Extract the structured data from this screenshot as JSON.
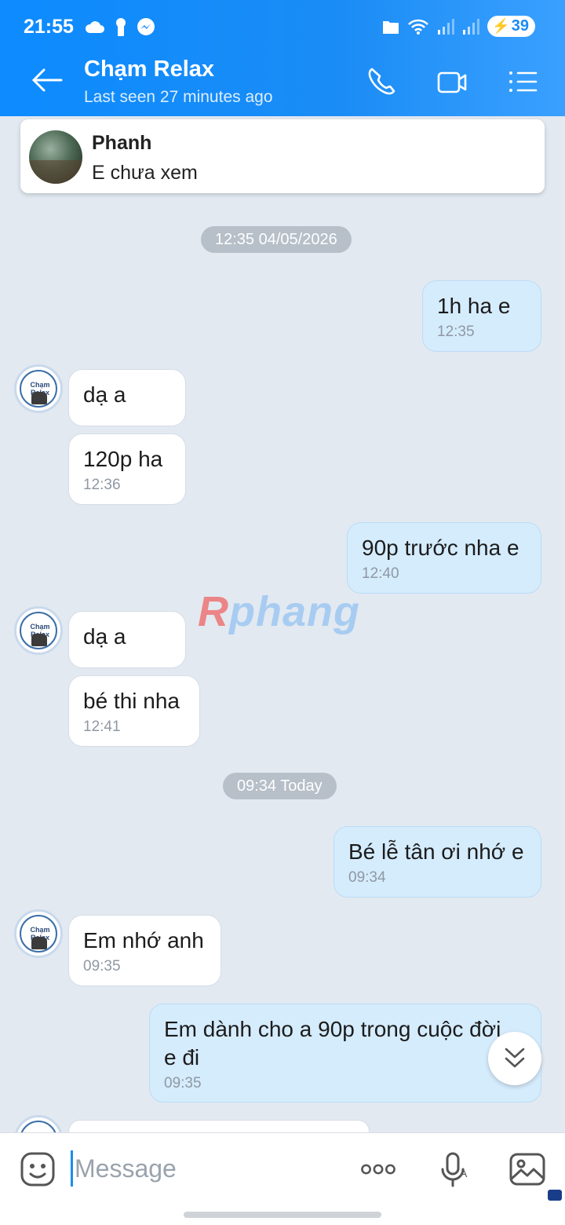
{
  "status_bar": {
    "time": "21:55",
    "battery": "39"
  },
  "header": {
    "title": "Chạm Relax",
    "subtitle": "Last seen 27 minutes ago"
  },
  "pinned": {
    "sender": "Phanh",
    "text": "E chưa xem"
  },
  "chips": [
    "12:35 04/05/2026",
    "09:34 Today"
  ],
  "messages": [
    {
      "dir": "out",
      "text": "1h ha e",
      "time": "12:35"
    },
    {
      "dir": "in",
      "text": "dạ a",
      "time": ""
    },
    {
      "dir": "in",
      "text": "120p ha",
      "time": "12:36"
    },
    {
      "dir": "out",
      "text": "90p trước nha e",
      "time": "12:40"
    },
    {
      "dir": "in",
      "text": "dạ a",
      "time": ""
    },
    {
      "dir": "in",
      "text": "bé thi nha",
      "time": "12:41"
    },
    {
      "dir": "out",
      "text": "Bé lễ tân ơi nhớ e",
      "time": "09:34"
    },
    {
      "dir": "in",
      "text": "Em nhớ anh",
      "time": "09:35"
    },
    {
      "dir": "out",
      "text": "Em dành cho a 90p trong cuộc đời\ne đi",
      "time": "09:35"
    }
  ],
  "avatar_label": "Chạm Relax",
  "watermark": "Rphang",
  "input": {
    "placeholder": "Message"
  },
  "colors": {
    "header": "#1a8cf5",
    "outgoing_bubble": "#d5ecfd",
    "incoming_bubble": "#ffffff",
    "background": "#e2e9f1"
  }
}
